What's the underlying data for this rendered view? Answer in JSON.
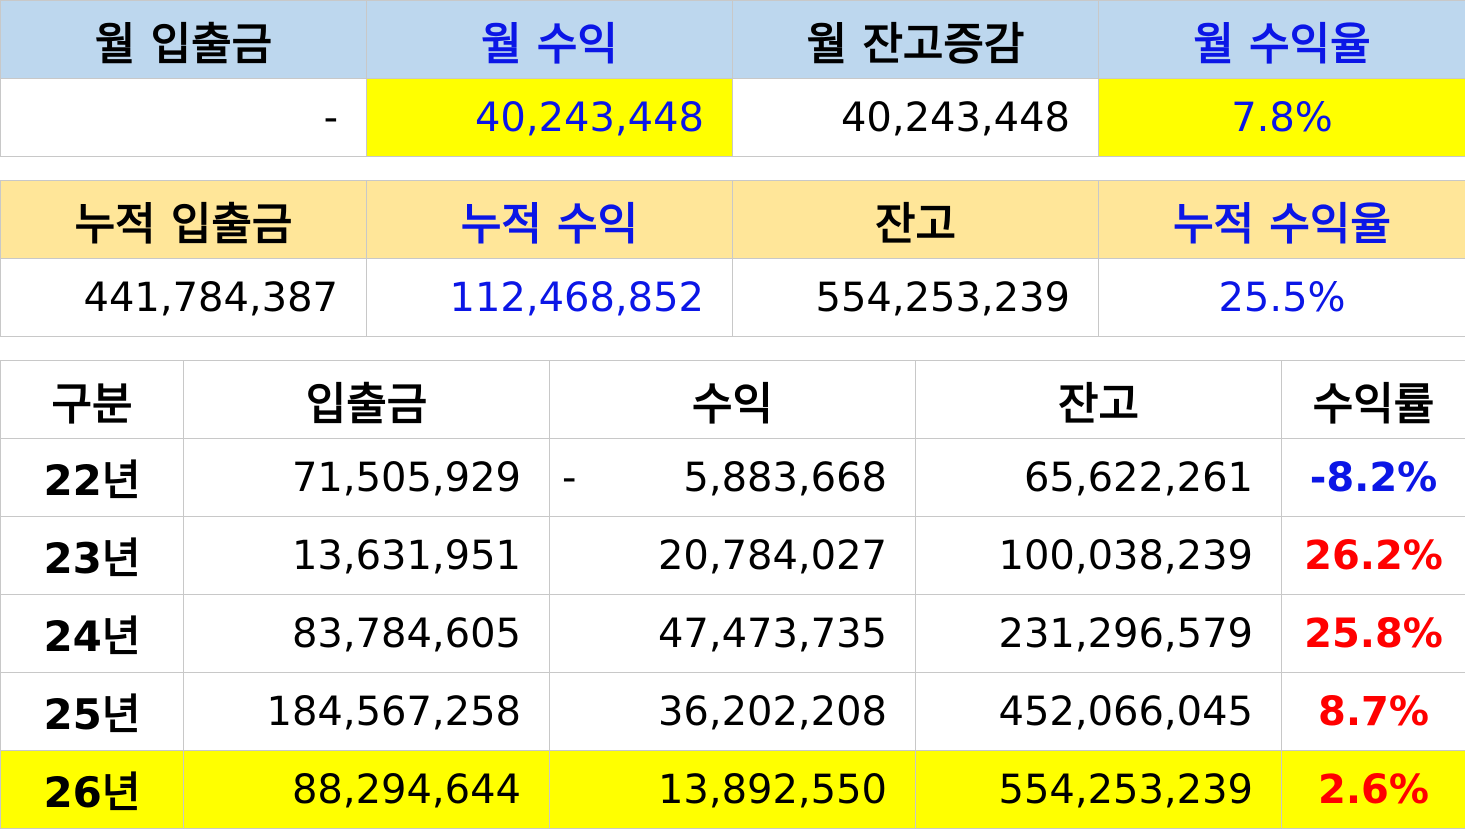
{
  "monthly": {
    "headers": [
      "월 입출금",
      "월 수익",
      "월 잔고증감",
      "월 수익율"
    ],
    "values": [
      "-",
      "40,243,448",
      "40,243,448",
      "7.8%"
    ]
  },
  "cumulative": {
    "headers": [
      "누적 입출금",
      "누적 수익",
      "잔고",
      "누적 수익율"
    ],
    "values": [
      "441,784,387",
      "112,468,852",
      "554,253,239",
      "25.5%"
    ]
  },
  "yearly": {
    "headers": [
      "구분",
      "입출금",
      "수익",
      "잔고",
      "수익률"
    ],
    "rows": [
      {
        "label": "22년",
        "deposit": "71,505,929",
        "profit_sign": "-",
        "profit": "5,883,668",
        "balance": "65,622,261",
        "rate": "-8.2%"
      },
      {
        "label": "23년",
        "deposit": "13,631,951",
        "profit_sign": "",
        "profit": "20,784,027",
        "balance": "100,038,239",
        "rate": "26.2%"
      },
      {
        "label": "24년",
        "deposit": "83,784,605",
        "profit_sign": "",
        "profit": "47,473,735",
        "balance": "231,296,579",
        "rate": "25.8%"
      },
      {
        "label": "25년",
        "deposit": "184,567,258",
        "profit_sign": "",
        "profit": "36,202,208",
        "balance": "452,066,045",
        "rate": "8.7%"
      },
      {
        "label": "26년",
        "deposit": "88,294,644",
        "profit_sign": "",
        "profit": "13,892,550",
        "balance": "554,253,239",
        "rate": "2.6%"
      }
    ]
  },
  "colors": {
    "header_monthly": "#bdd7ee",
    "header_cumulative": "#ffe699",
    "highlight": "#ffff00",
    "blue_text": "#0b16e6",
    "red_text": "#ff0000"
  }
}
